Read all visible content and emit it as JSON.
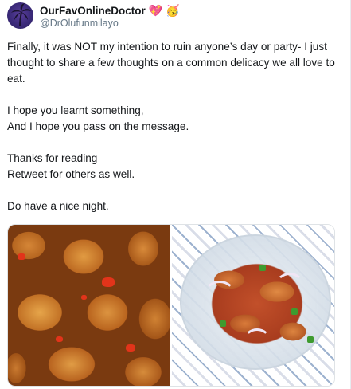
{
  "author": {
    "display_name": "OurFavOnlineDoctor",
    "handle": "@DrOlufunmilayo",
    "emojis": [
      "💖",
      "🥳"
    ]
  },
  "tweet": {
    "paragraphs": [
      [
        "Finally, it was NOT my intention to ruin anyone’s day or party- I just thought to share a few thoughts on a common delicacy we all love to eat."
      ],
      [
        "I hope you learnt something,",
        "And I hope you pass on the message."
      ],
      [
        "Thanks for reading",
        "Retweet for others as well."
      ],
      [
        "Do have a nice night."
      ]
    ]
  },
  "media": {
    "icons": [
      "cow-skin-pieces-photo",
      "pepper-ponmo-bowl-photo"
    ]
  },
  "colors": {
    "text": "#14171a",
    "secondary": "#657786",
    "border": "#e6ecf0"
  }
}
